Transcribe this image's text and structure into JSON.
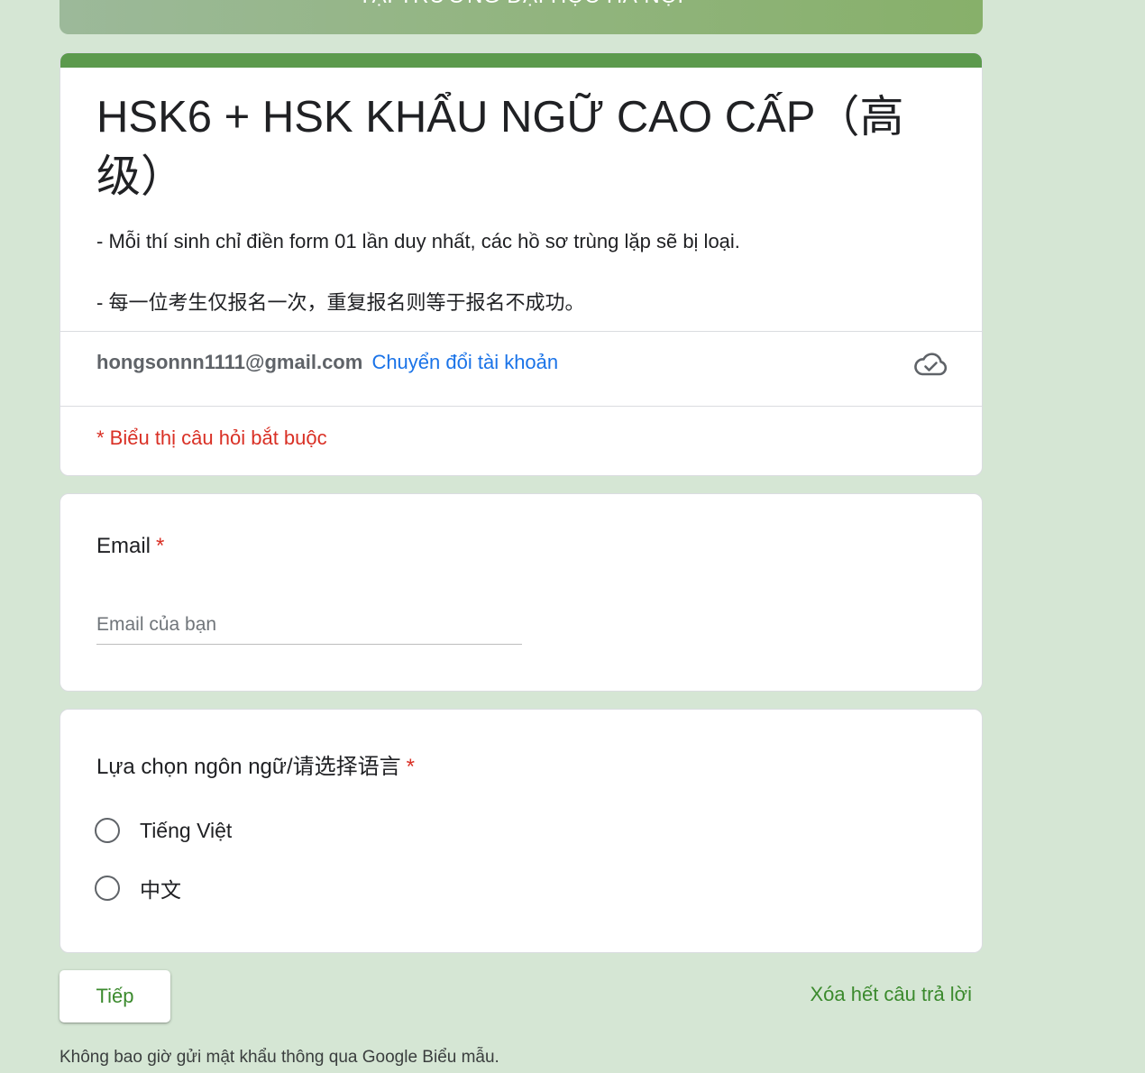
{
  "banner": {
    "text": "TẠI TRƯỜNG ĐẠI HỌC HÀ NỘI"
  },
  "form": {
    "title": "HSK6 + HSK KHẨU NGỮ CAO CẤP（高级）",
    "description_vi": "- Mỗi thí sinh chỉ điền form 01 lần duy nhất, các hồ sơ trùng lặp sẽ bị loại.",
    "description_zh": "- 每一位考生仅报名一次，重复报名则等于报名不成功。",
    "account_email": "hongsonnn1111@gmail.com",
    "switch_account_label": "Chuyển đổi tài khoản",
    "cloud_icon": "cloud-check-icon",
    "required_note": "* Biểu thị câu hỏi bắt buộc"
  },
  "questions": {
    "email": {
      "label": "Email",
      "required_mark": "*",
      "placeholder": "Email của bạn",
      "value": ""
    },
    "language": {
      "label": "Lựa chọn ngôn ngữ/请选择语言",
      "required_mark": "*",
      "options": [
        {
          "label": "Tiếng Việt",
          "selected": false
        },
        {
          "label": "中文",
          "selected": false
        }
      ]
    }
  },
  "actions": {
    "next_label": "Tiếp",
    "clear_label": "Xóa hết câu trả lời"
  },
  "footer": {
    "note": "Không bao giờ gửi mật khẩu thông qua Google Biểu mẫu."
  },
  "colors": {
    "page_background": "#d5e6d4",
    "accent_green": "#5c9a4d",
    "button_text_green": "#3b8a2d",
    "link_blue": "#1a73e8",
    "required_red": "#d93025"
  }
}
